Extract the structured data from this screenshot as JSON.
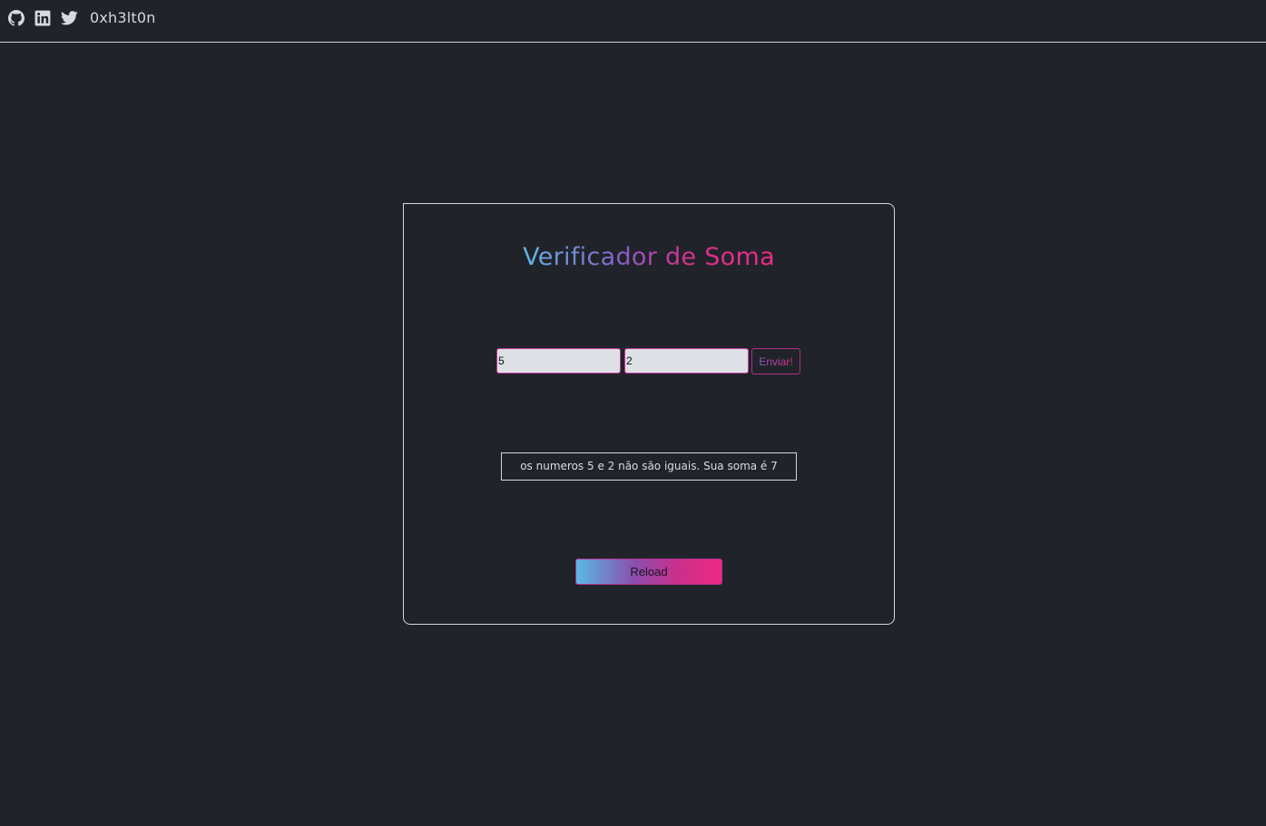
{
  "header": {
    "icons": [
      "github-icon",
      "linkedin-icon",
      "twitter-icon"
    ],
    "brand": "0xh3lt0n"
  },
  "card": {
    "title": "Verificador de Soma",
    "input_a_value": "5",
    "input_b_value": "2",
    "send_label": "Enviar!",
    "result_text": "os numeros 5 e 2 não são iguais. Sua soma é 7",
    "reload_label": "Reload"
  },
  "colors": {
    "background": "#202329",
    "gradient_start": "#5fb8e6",
    "gradient_end": "#ef2a86",
    "accent_border": "#c23a9b",
    "input_background": "#dfdfe6"
  }
}
